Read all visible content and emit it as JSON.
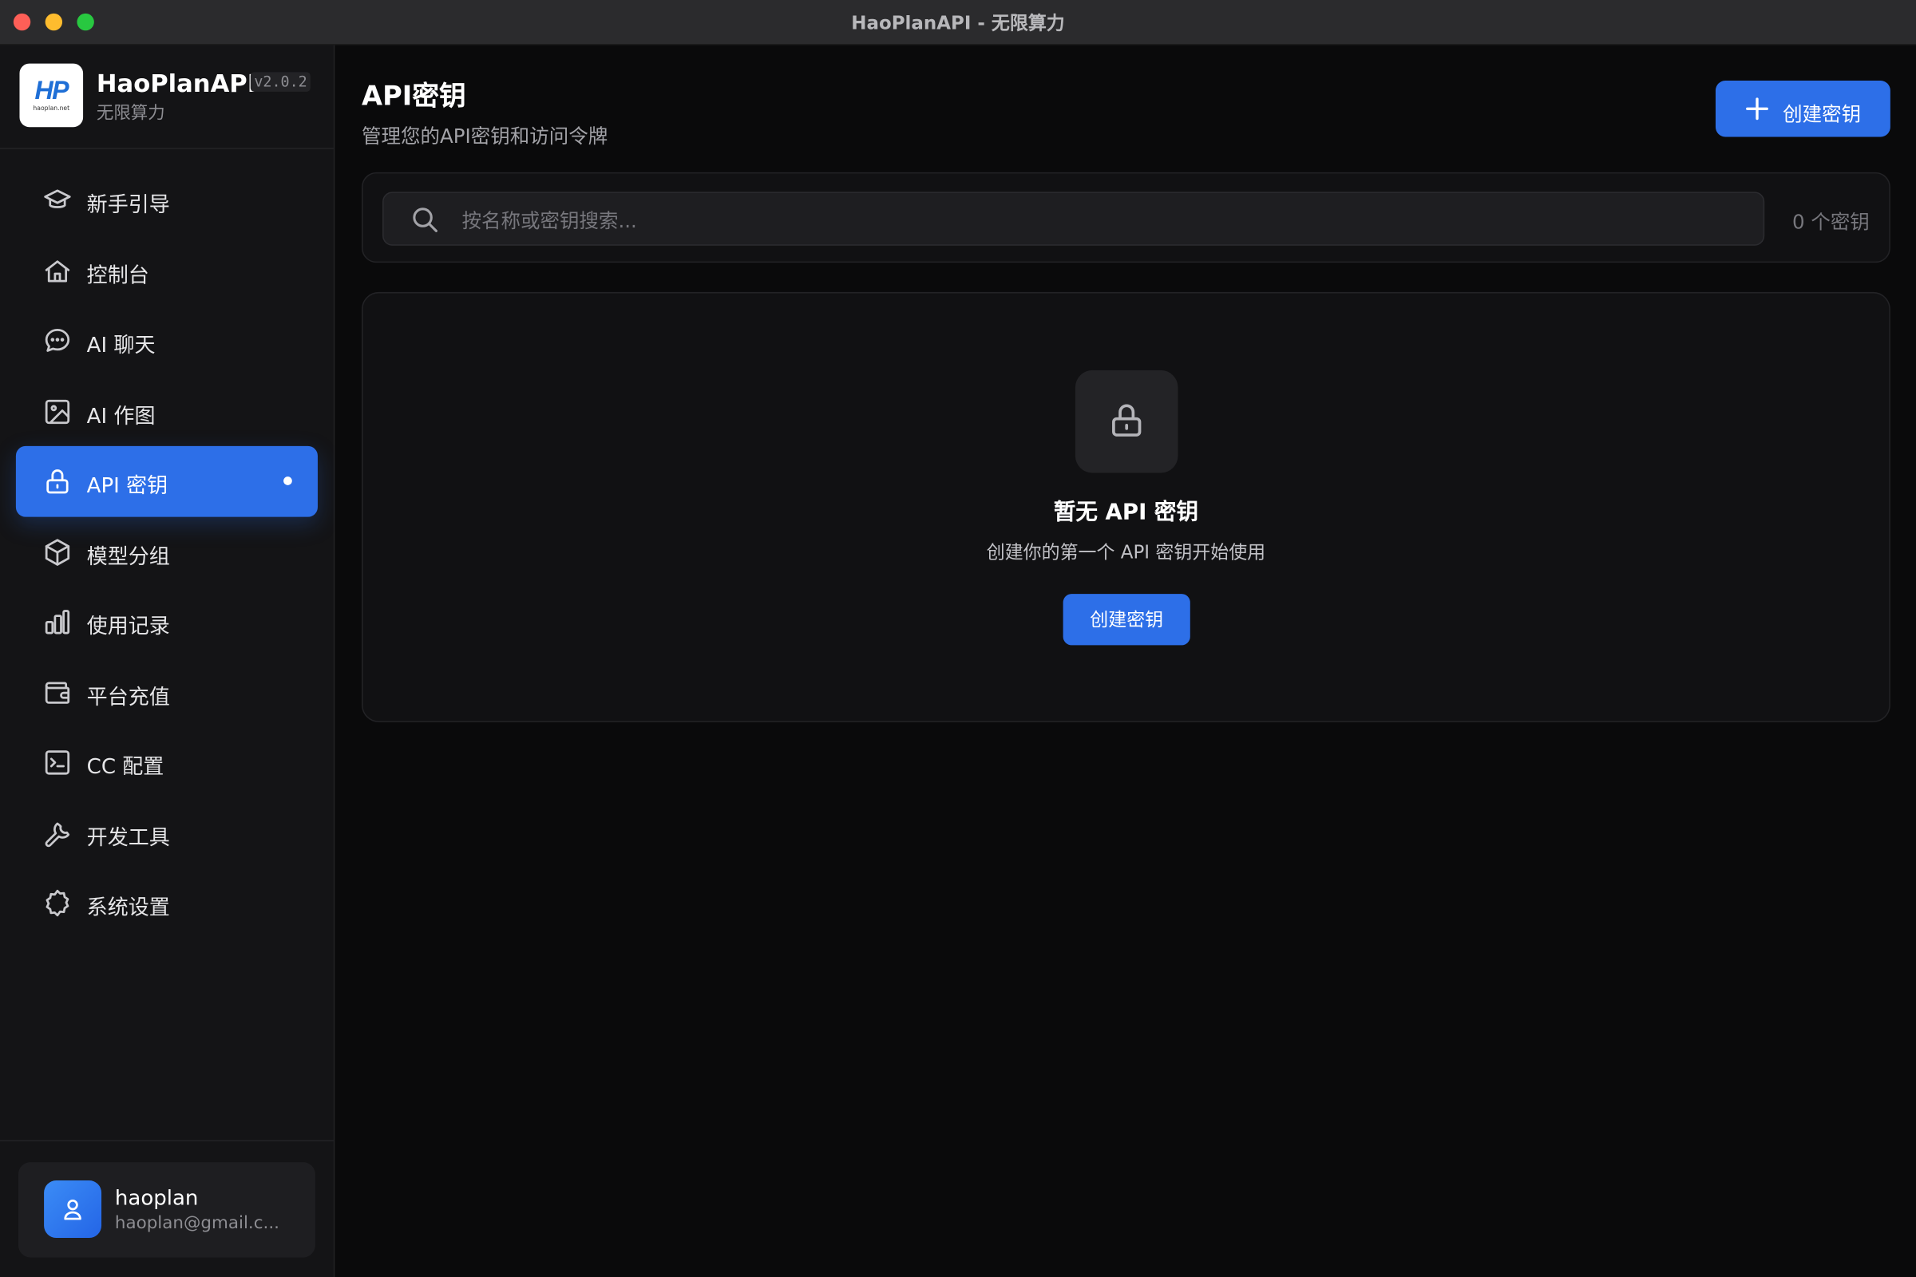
{
  "window": {
    "title": "HaoPlanAPI - 无限算力"
  },
  "brand": {
    "logo_letters": "HP",
    "logo_subtext": "haoplan.net",
    "name": "HaoPlanAPI",
    "version": "v2.0.2",
    "tagline": "无限算力"
  },
  "sidebar": {
    "items": [
      {
        "label": "新手引导",
        "icon": "graduation-cap-icon",
        "active": false
      },
      {
        "label": "控制台",
        "icon": "home-icon",
        "active": false
      },
      {
        "label": "AI 聊天",
        "icon": "chat-bubble-icon",
        "active": false
      },
      {
        "label": "AI 作图",
        "icon": "image-icon",
        "active": false
      },
      {
        "label": "API 密钥",
        "icon": "lock-icon",
        "active": true
      },
      {
        "label": "模型分组",
        "icon": "cube-icon",
        "active": false
      },
      {
        "label": "使用记录",
        "icon": "bar-chart-icon",
        "active": false
      },
      {
        "label": "平台充值",
        "icon": "wallet-icon",
        "active": false
      },
      {
        "label": "CC 配置",
        "icon": "terminal-icon",
        "active": false
      },
      {
        "label": "开发工具",
        "icon": "wrench-icon",
        "active": false
      },
      {
        "label": "系统设置",
        "icon": "gear-icon",
        "active": false
      }
    ]
  },
  "user": {
    "name": "haoplan",
    "email": "haoplan@gmail.c..."
  },
  "header": {
    "title": "API密钥",
    "subtitle": "管理您的API密钥和访问令牌",
    "create_button_label": "创建密钥"
  },
  "search": {
    "placeholder": "按名称或密钥搜索...",
    "value": "",
    "count_text": "0 个密钥"
  },
  "empty_state": {
    "icon": "lock-icon",
    "title": "暂无 API 密钥",
    "description": "创建你的第一个 API 密钥开始使用",
    "button_label": "创建密钥"
  },
  "colors": {
    "accent": "#2d6fe8",
    "background": "#0a0a0b",
    "sidebar": "#141416",
    "card": "#111113"
  }
}
